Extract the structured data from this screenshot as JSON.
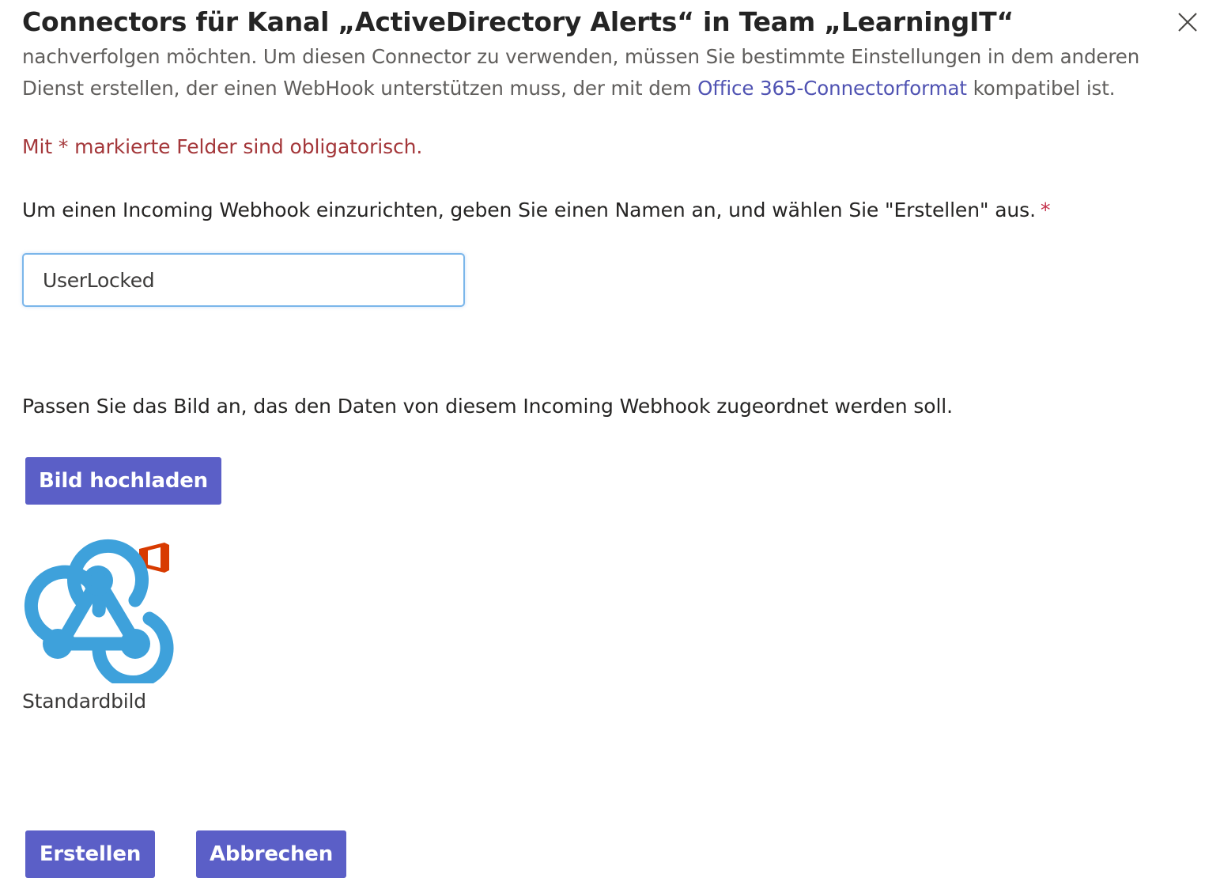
{
  "dialog": {
    "title": "Connectors für Kanal „ActiveDirectory Alerts“ in Team „LearningIT“",
    "close_icon": "close-icon"
  },
  "intro": {
    "line1": "nachverfolgen möchten. Um diesen Connector zu verwenden, müssen Sie bestimmte Einstellungen in dem anderen",
    "line2_before": "Dienst erstellen, der einen WebHook unterstützen muss, der mit dem ",
    "link_text": "Office 365-Connectorformat",
    "line2_after": " kompatibel ist."
  },
  "required_note": "Mit * markierte Felder sind obligatorisch.",
  "name_field": {
    "label": "Um einen Incoming Webhook einzurichten, geben Sie einen Namen an, und wählen Sie \"Erstellen\" aus.",
    "required_marker": "*",
    "value": "UserLocked"
  },
  "image_section": {
    "label": "Passen Sie das Bild an, das den Daten von diesem Incoming Webhook zugeordnet werden soll.",
    "upload_button": "Bild hochladen",
    "image_icon": "webhook-icon",
    "caption": "Standardbild"
  },
  "footer": {
    "create_button": "Erstellen",
    "cancel_button": "Abbrechen"
  },
  "colors": {
    "primary_button": "#5b5fc7",
    "link": "#4f52b2",
    "required_text": "#a4373a",
    "webhook_blue": "#3ea1db",
    "office_red": "#d83b01"
  }
}
